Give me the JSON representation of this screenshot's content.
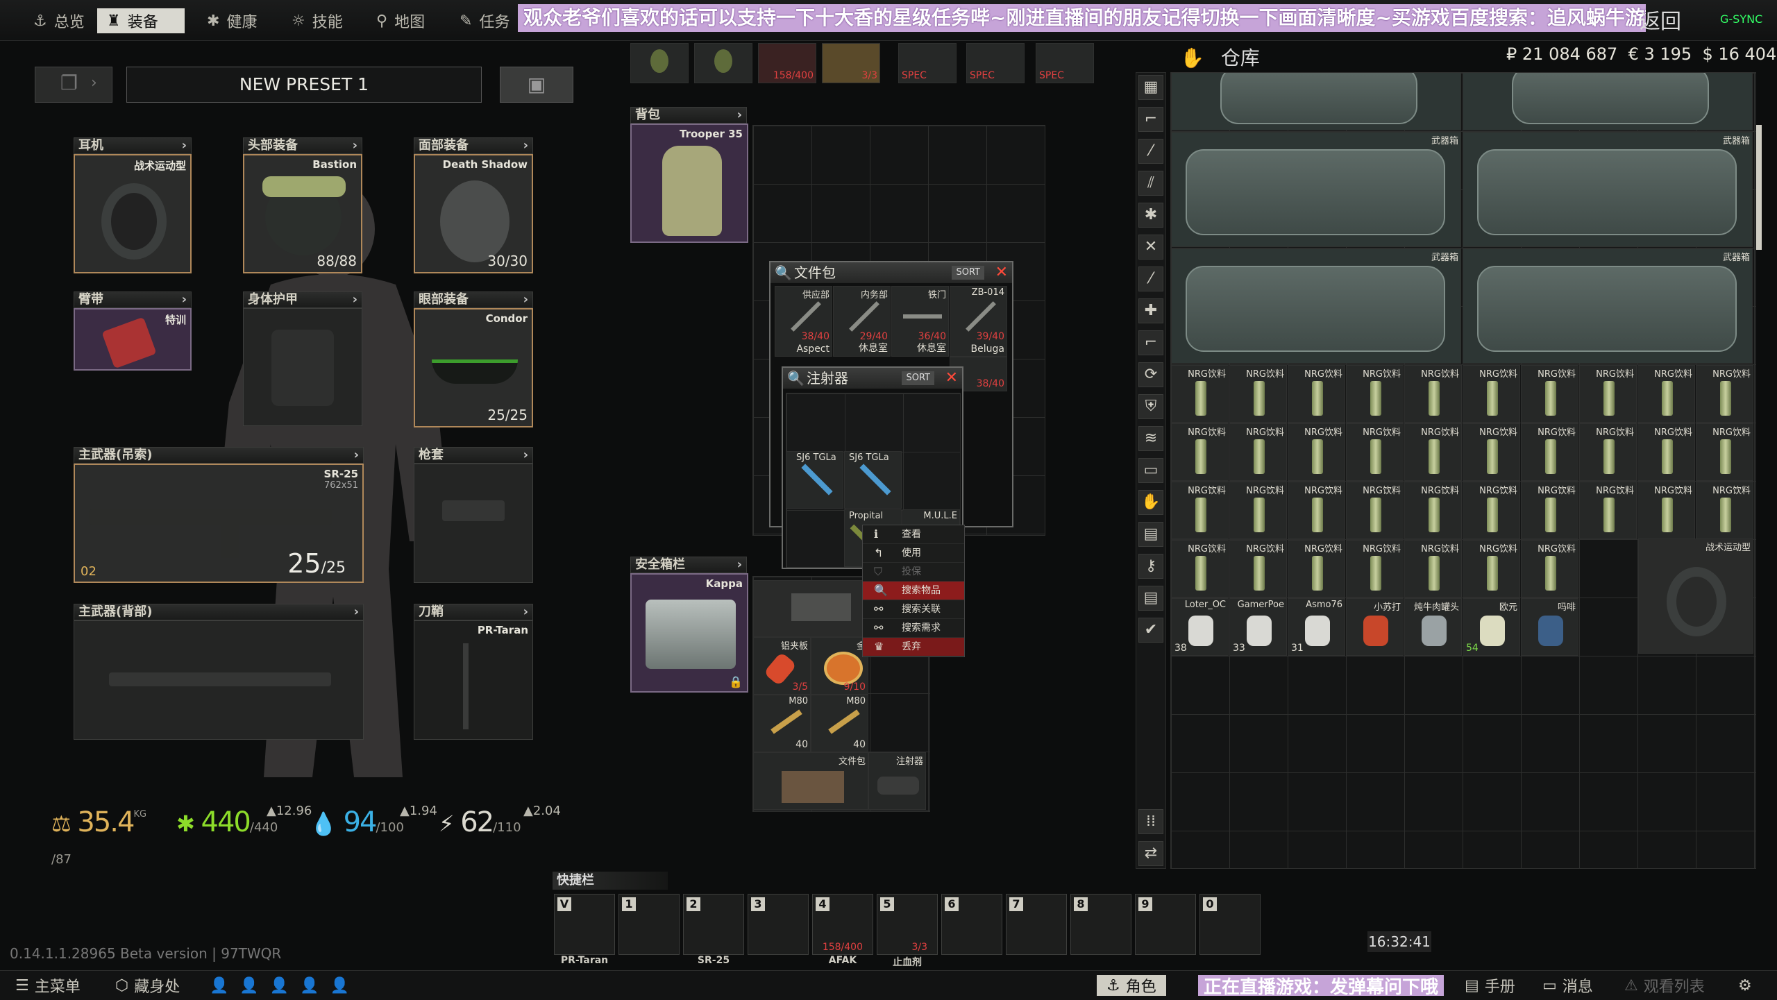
{
  "topbar": {
    "tabs": [
      {
        "label": "总览",
        "icon": "anchor-icon"
      },
      {
        "label": "装备",
        "icon": "gear-icon"
      },
      {
        "label": "健康",
        "icon": "health-icon"
      },
      {
        "label": "技能",
        "icon": "skills-icon"
      },
      {
        "label": "地图",
        "icon": "map-pin-icon"
      },
      {
        "label": "任务",
        "icon": "tasks-icon"
      }
    ],
    "active_tab": "装备",
    "banner": "观众老爷们喜欢的话可以支持一下十大香的星级任务哔~刚进直播间的朋友记得切换一下画面清晰度~买游戏百度搜索：追风蜗牛游戏",
    "back_label": "返回",
    "fps": "G-SYNC"
  },
  "preset": {
    "name": "NEW PRESET 1"
  },
  "equipment": {
    "earpiece": {
      "header": "耳机",
      "item": "战术运动型"
    },
    "headwear": {
      "header": "头部装备",
      "item": "Bastion",
      "durability": "88/88"
    },
    "facecover": {
      "header": "面部装备",
      "item": "Death Shadow",
      "durability": "30/30"
    },
    "armband": {
      "header": "臂带",
      "item": "特训"
    },
    "body_armor": {
      "header": "身体护甲"
    },
    "eyewear": {
      "header": "眼部装备",
      "item": "Condor",
      "durability": "25/25"
    },
    "primary_sling": {
      "header": "主武器(吊索)",
      "item": "SR-25",
      "caliber": "762x51",
      "ammo": "25",
      "ammo_max": "/25",
      "level": "02"
    },
    "holster": {
      "header": "枪套"
    },
    "primary_back": {
      "header": "主武器(背部)"
    },
    "scabbard": {
      "header": "刀鞘",
      "item": "PR-Taran"
    }
  },
  "stats": {
    "weight": "35.4",
    "weight_unit": "KG",
    "weight_max": "/87",
    "health": "440",
    "health_max": "/440",
    "health_delta": "▲12.96",
    "hydration": "94",
    "hydration_max": "/100",
    "hydration_delta": "▲1.94",
    "energy": "62",
    "energy_max": "/110",
    "energy_delta": "▲2.04"
  },
  "top_strip": [
    {
      "label": ""
    },
    {
      "label": ""
    },
    {
      "label": "158/400"
    },
    {
      "label": "3/3"
    },
    {
      "label": "SPEC"
    },
    {
      "label": "SPEC"
    },
    {
      "label": "SPEC"
    }
  ],
  "backpack": {
    "header": "背包",
    "item": "Trooper 35"
  },
  "secure": {
    "header": "安全箱栏",
    "item": "Kappa"
  },
  "docs_window": {
    "title": "文件包",
    "sort": "SORT",
    "items": [
      {
        "top": "供应部",
        "count": "38/40",
        "bottom": "Aspect"
      },
      {
        "top": "内务部",
        "count": "29/40",
        "bottom": "休息室"
      },
      {
        "top": "铁门",
        "count": "36/40",
        "bottom": "休息室"
      },
      {
        "top": "ZB-014",
        "count": "39/40",
        "bottom": "Beluga"
      },
      {
        "top": "",
        "count": "38/40",
        "bottom": ""
      }
    ]
  },
  "injector_window": {
    "title": "注射器",
    "sort": "SORT",
    "items": [
      {
        "label": "SJ6 TGLa"
      },
      {
        "label": "SJ6 TGLa"
      },
      {
        "label": "Propital"
      },
      {
        "label": "M.U.L.E"
      }
    ]
  },
  "context_menu": [
    {
      "label": "查看",
      "icon": "info-icon",
      "state": "normal"
    },
    {
      "label": "使用",
      "icon": "use-icon",
      "state": "normal"
    },
    {
      "label": "投保",
      "icon": "insure-icon",
      "state": "disabled"
    },
    {
      "label": "搜索物品",
      "icon": "search-icon",
      "state": "selected"
    },
    {
      "label": "搜索关联",
      "icon": "link-icon",
      "state": "normal"
    },
    {
      "label": "搜索需求",
      "icon": "require-icon",
      "state": "normal"
    },
    {
      "label": "丢弃",
      "icon": "discard-icon",
      "state": "danger"
    }
  ],
  "pockets_lower": [
    {
      "label": "铝夹板",
      "count": "3/5"
    },
    {
      "label": "金",
      "count": "9/10"
    },
    {
      "label": "M80",
      "count": "40"
    },
    {
      "label": "M80",
      "count": "40"
    },
    {
      "label": "文件包",
      "count": ""
    },
    {
      "label": "注射器",
      "count": ""
    }
  ],
  "stash": {
    "title": "仓库",
    "rub": "₽ 21 084 687",
    "eur": "€ 3 195",
    "usd": "$ 16 404",
    "weapon_case_label": "武器箱",
    "nrg_label": "NRG饮料",
    "row_bottom": [
      {
        "label": "Loter_OC",
        "count": "38"
      },
      {
        "label": "GamerPoe",
        "count": "33"
      },
      {
        "label": "Asmo76",
        "count": "31"
      },
      {
        "label": "小苏打",
        "count": ""
      },
      {
        "label": "炖牛肉罐头",
        "count": ""
      },
      {
        "label": "欧元",
        "count": "54"
      },
      {
        "label": "吗啡",
        "count": ""
      }
    ],
    "headset_label": "战术运动型"
  },
  "hotbar": {
    "header": "快捷栏",
    "slots": [
      {
        "key": "V",
        "name": "PR-Taran"
      },
      {
        "key": "1",
        "name": ""
      },
      {
        "key": "2",
        "name": "SR-25"
      },
      {
        "key": "3",
        "name": ""
      },
      {
        "key": "4",
        "name": "AFAK",
        "count": "158/400"
      },
      {
        "key": "5",
        "name": "止血剂",
        "count": "3/3"
      },
      {
        "key": "6",
        "name": ""
      },
      {
        "key": "7",
        "name": ""
      },
      {
        "key": "8",
        "name": ""
      },
      {
        "key": "9",
        "name": ""
      },
      {
        "key": "0",
        "name": ""
      }
    ]
  },
  "version": "0.14.1.1.28965 Beta version | 97TWQR",
  "clock": "16:32:41",
  "bottombar": {
    "main_menu": "主菜单",
    "hideout": "藏身处",
    "character": "角色",
    "live_banner": "正在直播游戏：发弹幕问下哦",
    "handbook": "手册",
    "messages": "消息",
    "watchlist": "观看列表"
  }
}
